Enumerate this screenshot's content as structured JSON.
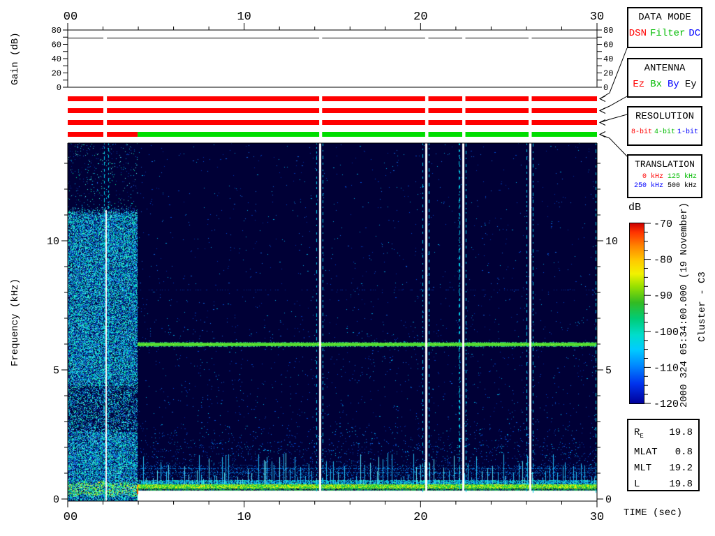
{
  "labels": {
    "gain_ylabel": "Gain (dB)",
    "freq_ylabel": "Frequency (kHz)",
    "time_axis_label": "TIME (sec)",
    "colorbar_unit": "dB",
    "datetime": "2000 324 05:34:00.000 (19 November)",
    "spacecraft": "Cluster - C3"
  },
  "boxes": {
    "data_mode": {
      "title": "DATA MODE",
      "options": [
        {
          "label": "DSN",
          "color": "#ff0000"
        },
        {
          "label": "Filter",
          "color": "#00bb00"
        },
        {
          "label": "DC",
          "color": "#0000ff"
        }
      ]
    },
    "antenna": {
      "title": "ANTENNA",
      "options": [
        {
          "label": "Ez",
          "color": "#ff0000"
        },
        {
          "label": "Bx",
          "color": "#00bb00"
        },
        {
          "label": "By",
          "color": "#0000ff"
        },
        {
          "label": "Ey",
          "color": "#000000"
        }
      ]
    },
    "resolution": {
      "title": "RESOLUTION",
      "options": [
        {
          "label": "8-bit",
          "color": "#ff0000"
        },
        {
          "label": "4-bit",
          "color": "#00bb00"
        },
        {
          "label": "1-bit",
          "color": "#0000ff"
        }
      ]
    },
    "translation": {
      "title": "TRANSLATION",
      "row1": [
        {
          "label": "0 kHz",
          "color": "#ff0000"
        },
        {
          "label": "125 kHz",
          "color": "#00bb00"
        }
      ],
      "row2": [
        {
          "label": "250 kHz",
          "color": "#0000ff"
        },
        {
          "label": "500 kHz",
          "color": "#000000"
        }
      ]
    }
  },
  "info_table": {
    "rows": [
      {
        "label": "R",
        "sub": "E",
        "value": "19.8"
      },
      {
        "label": "MLAT",
        "sub": "",
        "value": "0.8"
      },
      {
        "label": "MLT",
        "sub": "",
        "value": "19.2"
      },
      {
        "label": "L",
        "sub": "",
        "value": "19.8"
      }
    ]
  },
  "status_bars": {
    "gaps_sec": [
      [
        2.02,
        2.22
      ],
      [
        14.25,
        14.42
      ],
      [
        20.26,
        20.44
      ],
      [
        22.36,
        22.54
      ],
      [
        26.12,
        26.3
      ]
    ],
    "rows": [
      {
        "name": "data-mode-bar",
        "segments": [
          {
            "t": [
              0,
              30
            ],
            "color": "#ff0000",
            "mode": "DSN"
          }
        ]
      },
      {
        "name": "antenna-bar",
        "segments": [
          {
            "t": [
              0,
              30
            ],
            "color": "#ff0000",
            "mode": "Ez"
          }
        ]
      },
      {
        "name": "resolution-bar",
        "segments": [
          {
            "t": [
              0,
              30
            ],
            "color": "#ff0000",
            "mode": "8-bit"
          }
        ]
      },
      {
        "name": "translation-bar",
        "segments": [
          {
            "t": [
              0,
              3.96
            ],
            "color": "#ff0000",
            "mode": "0 kHz"
          },
          {
            "t": [
              3.96,
              30
            ],
            "color": "#00dd00",
            "mode": "125 kHz"
          }
        ]
      }
    ]
  },
  "chart_data": [
    {
      "type": "line",
      "title": "Receiver gain vs time",
      "ylabel": "Gain (dB)",
      "x_range_sec": [
        0,
        30
      ],
      "ylim": [
        0,
        80
      ],
      "xticks": [
        0,
        10,
        20,
        30
      ],
      "xtick_labels": [
        "00",
        "10",
        "20",
        "30"
      ],
      "minor_xtick_step_sec": 2,
      "yticks": [
        0,
        20,
        40,
        60,
        80
      ],
      "minor_ytick_step_db": 10,
      "series": [
        {
          "name": "receiver-gain",
          "value_db": 70,
          "gaps_sec": [
            [
              2.02,
              2.22
            ],
            [
              14.25,
              14.42
            ],
            [
              20.26,
              20.44
            ],
            [
              22.36,
              22.54
            ],
            [
              26.12,
              26.3
            ]
          ]
        }
      ]
    },
    {
      "type": "heatmap",
      "subtype": "spectrogram",
      "xlabel": "TIME (sec)",
      "ylabel": "Frequency (kHz)",
      "x_range_sec": [
        0,
        30
      ],
      "y_range_khz": [
        0,
        13.8
      ],
      "yticks": [
        0,
        5,
        10
      ],
      "minor_ytick_step_khz": 1,
      "xticks": [
        0,
        10,
        20,
        30
      ],
      "xtick_labels": [
        "00",
        "10",
        "20",
        "30"
      ],
      "minor_xtick_step_sec": 2,
      "colorbar": {
        "label": "dB",
        "min": -120,
        "max": -70,
        "ticks": [
          -70,
          -80,
          -90,
          -100,
          -110,
          -120
        ],
        "minor_tick_step": 2.5,
        "gradient": [
          "#cc0000 0%",
          "#ff3300 5%",
          "#ff8800 13%",
          "#ffcc00 21%",
          "#f2f200 28%",
          "#99e000 35%",
          "#33bb22 44%",
          "#00cc77 53%",
          "#00ddcc 62%",
          "#00ccff 70%",
          "#0088ff 79%",
          "#0033ee 89%",
          "#000099 100%"
        ]
      },
      "colors": {
        "background": "#000036",
        "no_data": "#ffffff",
        "dropout_line": "#ffffff",
        "dash_line": "#00d2ee",
        "speckle": [
          "#0033aa",
          "#0048cc",
          "#1166dd",
          "#00aadd"
        ],
        "burst": [
          "#00ccee",
          "#00aadd",
          "#33ddcc",
          "#2266ee",
          "#0044bb",
          "#003399",
          "#55eedd",
          "#00ee99",
          "#001a77"
        ],
        "band": [
          "#33ee55",
          "#aaff33",
          "#ffee33",
          "#00cc77",
          "#66ddff",
          "#22bb44"
        ],
        "narrowband_line": "#55dd33"
      },
      "features": {
        "mode_change_sec": 3.96,
        "broadband_burst": {
          "time_sec": [
            0,
            3.96
          ],
          "freq_khz": [
            0,
            11.0
          ]
        },
        "narrowband_khz": 6.0,
        "bottom_band_khz": [
          0.45,
          0.8
        ],
        "spike_band_top_khz": 1.9,
        "no_data_strip_khz": [
          0,
          0.33
        ],
        "dropout_times_sec": [
          2.18,
          14.29,
          20.3,
          22.4,
          26.2
        ],
        "faint_lines_khz": [
          {
            "f": 8.1,
            "color": "#00309e",
            "d": 0.22
          },
          {
            "f": 1.19,
            "color": "#0080dd",
            "d": 0.5
          },
          {
            "f": 1.03,
            "color": "#0077cc",
            "d": 0.5
          }
        ]
      }
    }
  ]
}
